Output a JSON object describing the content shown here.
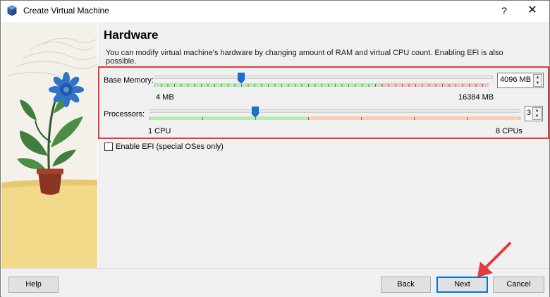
{
  "window": {
    "title": "Create Virtual Machine",
    "help_glyph": "?",
    "close_glyph": "✕"
  },
  "page": {
    "heading": "Hardware",
    "description": "You can modify virtual machine's hardware by changing amount of RAM and virtual CPU count. Enabling EFI is also possible."
  },
  "memory": {
    "label": "Base Memory:",
    "value": "4096 MB",
    "min_label": "4 MB",
    "max_label": "16384 MB",
    "current_mb": 4096,
    "min_mb": 4,
    "max_mb": 16384
  },
  "processors": {
    "label": "Processors:",
    "value": "3",
    "min_label": "1 CPU",
    "max_label": "8 CPUs",
    "current": 3,
    "min": 1,
    "max": 8
  },
  "efi": {
    "label": "Enable EFI (special OSes only)",
    "checked": false
  },
  "buttons": {
    "help": "Help",
    "back": "Back",
    "next": "Next",
    "cancel": "Cancel"
  },
  "colors": {
    "slider_green": "#b9eab6",
    "slider_red": "#f5c3bc",
    "cpu_red": "#f8cdb8",
    "thumb": "#1a6fd6",
    "highlight": "#e03a3e",
    "arrow": "#e23b3b",
    "default_button_border": "#0078d7"
  },
  "icons": {
    "app": "virtualbox-cube-icon",
    "illustration": "plant-pot-illustration",
    "annotation": "red-arrow-icon"
  }
}
